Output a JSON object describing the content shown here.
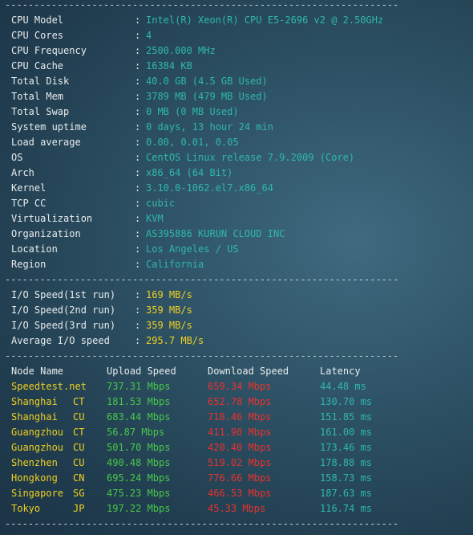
{
  "separator": "----------------------------------------------------------------------",
  "system_info": [
    {
      "label": "CPU Model",
      "value": "Intel(R) Xeon(R) CPU E5-2696 v2 @ 2.50GHz"
    },
    {
      "label": "CPU Cores",
      "value": "4"
    },
    {
      "label": "CPU Frequency",
      "value": "2500.000 MHz"
    },
    {
      "label": "CPU Cache",
      "value": "16384 KB"
    },
    {
      "label": "Total Disk",
      "value": "40.0 GB (4.5 GB Used)"
    },
    {
      "label": "Total Mem",
      "value": "3789 MB (479 MB Used)"
    },
    {
      "label": "Total Swap",
      "value": "0 MB (0 MB Used)"
    },
    {
      "label": "System uptime",
      "value": "0 days, 13 hour 24 min"
    },
    {
      "label": "Load average",
      "value": "0.00, 0.01, 0.05"
    },
    {
      "label": "OS",
      "value": "CentOS Linux release 7.9.2009 (Core)"
    },
    {
      "label": "Arch",
      "value": "x86_64 (64 Bit)"
    },
    {
      "label": "Kernel",
      "value": "3.10.0-1062.el7.x86_64"
    },
    {
      "label": "TCP CC",
      "value": "cubic"
    },
    {
      "label": "Virtualization",
      "value": "KVM"
    },
    {
      "label": "Organization",
      "value": "AS395886 KURUN CLOUD INC"
    },
    {
      "label": "Location",
      "value": "Los Angeles / US"
    },
    {
      "label": "Region",
      "value": "California"
    }
  ],
  "io_info": [
    {
      "label": "I/O Speed(1st run)",
      "value": "169 MB/s"
    },
    {
      "label": "I/O Speed(2nd run)",
      "value": "359 MB/s"
    },
    {
      "label": "I/O Speed(3rd run)",
      "value": "359 MB/s"
    },
    {
      "label": "Average I/O speed",
      "value": "295.7 MB/s"
    }
  ],
  "speed_table": {
    "headers": {
      "node": "Node Name",
      "upload": "Upload Speed",
      "download": "Download Speed",
      "latency": "Latency"
    },
    "rows": [
      {
        "node": "Speedtest.net",
        "isp": "",
        "upload": "737.31 Mbps",
        "download": "659.34 Mbps",
        "latency": "44.48 ms"
      },
      {
        "node": "Shanghai",
        "isp": "CT",
        "upload": "181.53 Mbps",
        "download": "652.78 Mbps",
        "latency": "130.70 ms"
      },
      {
        "node": "Shanghai",
        "isp": "CU",
        "upload": "683.44 Mbps",
        "download": "718.46 Mbps",
        "latency": "151.85 ms"
      },
      {
        "node": "Guangzhou",
        "isp": "CT",
        "upload": "56.87 Mbps",
        "download": "411.90 Mbps",
        "latency": "161.00 ms"
      },
      {
        "node": "Guangzhou",
        "isp": "CU",
        "upload": "501.70 Mbps",
        "download": "420.40 Mbps",
        "latency": "173.46 ms"
      },
      {
        "node": "Shenzhen",
        "isp": "CU",
        "upload": "490.48 Mbps",
        "download": "519.02 Mbps",
        "latency": "178.88 ms"
      },
      {
        "node": "Hongkong",
        "isp": "CN",
        "upload": "695.24 Mbps",
        "download": "776.66 Mbps",
        "latency": "158.73 ms"
      },
      {
        "node": "Singapore",
        "isp": "SG",
        "upload": "475.23 Mbps",
        "download": "466.53 Mbps",
        "latency": "187.63 ms"
      },
      {
        "node": "Tokyo",
        "isp": "JP",
        "upload": "197.22 Mbps",
        "download": "45.33 Mbps",
        "latency": "116.74 ms"
      }
    ]
  },
  "colors": {
    "label": "#e8ecee",
    "value": "#2fb8a9",
    "io_value": "#f0d020",
    "node": "#f0d020",
    "upload": "#48c848",
    "download": "#e8322e",
    "latency": "#2fb8a9"
  }
}
